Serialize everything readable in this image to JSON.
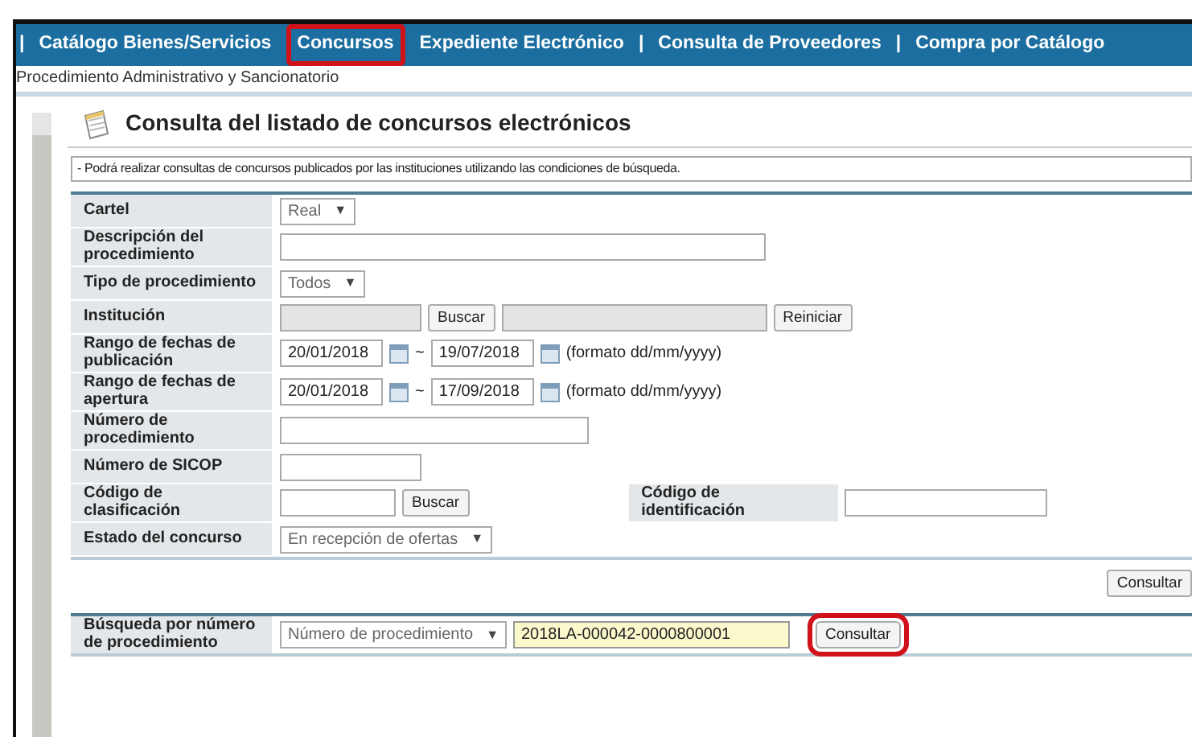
{
  "nav": {
    "items": [
      {
        "label": "Catálogo Bienes/Servicios",
        "separator": "|",
        "highlighted": false
      },
      {
        "label": "Concursos",
        "highlighted": true
      },
      {
        "label": "Expediente Electrónico",
        "highlighted": false
      },
      {
        "label": "Consulta de Proveedores",
        "separator": "|",
        "highlighted": false
      },
      {
        "label": "Compra por Catálogo",
        "separator": "|",
        "highlighted": false
      }
    ]
  },
  "subnav": "Procedimiento Administrativo y Sancionatorio",
  "page_title": "Consulta del listado de concursos electrónicos",
  "notice": "- Podrá realizar consultas de concursos publicados por las instituciones utilizando las condiciones de búsqueda.",
  "form": {
    "rows": [
      {
        "kind": "select",
        "label": "Cartel",
        "value": "Real",
        "caret": "▼"
      },
      {
        "kind": "text",
        "label": "Descripción del procedimiento"
      },
      {
        "kind": "select",
        "label": "Tipo de procedimiento",
        "value": "Todos",
        "caret": "▼"
      },
      {
        "kind": "lookup",
        "label": "Institución",
        "button": "Buscar",
        "reset": "Reiniciar"
      },
      {
        "kind": "daterange",
        "label": "Rango de fechas de publicación",
        "from": "20/01/2018",
        "tilde": "~",
        "to": "19/07/2018",
        "hint": "(formato dd/mm/yyyy)"
      },
      {
        "kind": "daterange",
        "label": "Rango de fechas de apertura",
        "from": "20/01/2018",
        "tilde": "~",
        "to": "17/09/2018",
        "hint": "(formato dd/mm/yyyy)"
      },
      {
        "kind": "text",
        "label": "Número de procedimiento"
      },
      {
        "kind": "text",
        "label": "Número de SICOP"
      },
      {
        "kind": "code",
        "label": "Código de clasificación",
        "button": "Buscar",
        "label2": "Código de identificación"
      },
      {
        "kind": "select",
        "label": "Estado del concurso",
        "value": "En recepción de ofertas",
        "caret": "▼"
      }
    ],
    "submit": {
      "label": "Consultar",
      "highlighted": false
    }
  },
  "quick_search": {
    "label": "Búsqueda por número de procedimiento",
    "select": "Número de procedimiento",
    "caret": "▼",
    "value": "2018LA-000042-0000800001",
    "button": {
      "label": "Consultar",
      "highlighted": true
    }
  }
}
